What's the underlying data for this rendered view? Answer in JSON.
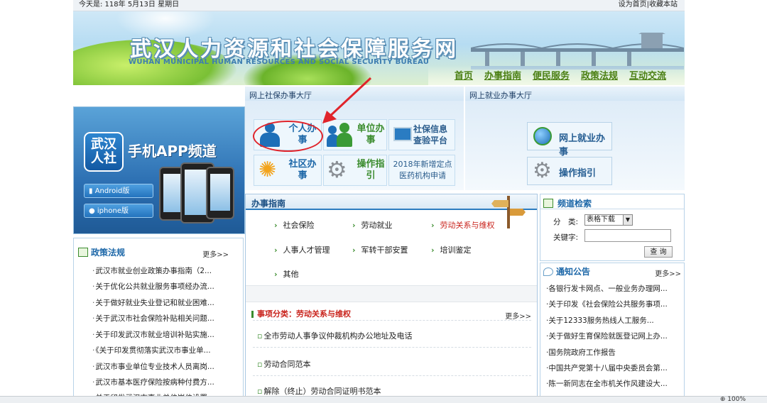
{
  "topbar": {
    "date_text": "今天是: 118年 5月13日 星期日",
    "links": [
      "设为首页",
      "收藏本站"
    ]
  },
  "banner": {
    "title": "武汉人力资源和社会保障服务网",
    "subtitle": "WUHAN MUNICIPAL HUMAN RESOURCES AND SOCIAL SECURITY BUREAU",
    "nav": [
      "首页",
      "办事指南",
      "便民服务",
      "政策法规",
      "互动交流"
    ]
  },
  "app_panel": {
    "logo_text": "武汉人社",
    "title": "手机APP频道",
    "buttons": [
      "Android版",
      "iphone版"
    ]
  },
  "social_hall": {
    "title": "网上社保办事大厅",
    "tiles": [
      {
        "label": "个人办事",
        "icon": "person-icon"
      },
      {
        "label": "单位办事",
        "icon": "group-icon"
      },
      {
        "label": "社保信息查验平台",
        "icon": "monitor-icon"
      },
      {
        "label": "社区办事",
        "icon": "flower-icon"
      },
      {
        "label": "操作指引",
        "icon": "gear-icon"
      },
      {
        "label": "2018年新增定点医药机构申请",
        "icon": ""
      }
    ]
  },
  "job_hall": {
    "title": "网上就业办事大厅",
    "tiles": [
      {
        "label": "网上就业办事",
        "icon": "globe-icon"
      },
      {
        "label": "操作指引",
        "icon": "gear-icon"
      }
    ]
  },
  "guide": {
    "title": "办事指南",
    "items": [
      "社会保险",
      "劳动就业",
      "劳动关系与维权",
      "人事人才管理",
      "军转干部安置",
      "培训鉴定",
      "其他"
    ],
    "active_index": 2,
    "category_label": "事项分类：",
    "category_value": "劳动关系与维权",
    "more": "更多>>",
    "category_items": [
      "全市劳动人事争议仲裁机构办公地址及电话",
      "劳动合同范本",
      "解除（终止）劳动合同证明书范本"
    ]
  },
  "policy": {
    "title": "政策法规",
    "more": "更多>>",
    "items": [
      "武汉市就业创业政策办事指南（2...",
      "关于优化公共就业服务事项经办流...",
      "关于做好就业失业登记和就业困难...",
      "关于武汉市社会保险补贴相关问题...",
      "关于印发武汉市就业培训补贴实施...",
      "《关于印发贯彻落实武汉市事业单...",
      "武汉市事业单位专业技术人员离岗...",
      "武汉市基本医疗保险按病种付费方...",
      "关于印发武汉市事业单位岗位设置..."
    ]
  },
  "search": {
    "title": "频道检索",
    "category_label": "分　类:",
    "category_value": "表格下载",
    "keyword_label": "关键字:",
    "keyword_value": "",
    "button": "查 询"
  },
  "notice": {
    "title": "通知公告",
    "more": "更多>>",
    "items": [
      "·各银行发卡网点、一般业务办理网...",
      "·关于印发《社会保险公共服务事项...",
      "·关于12333服务热线人工服务...",
      "·关于做好生育保险就医登记网上办...",
      "·国务院政府工作报告",
      "·中国共产党第十八届中央委员会第...",
      "·陈一新同志在全市机关作风建设大...",
      "·..."
    ]
  },
  "statusbar": {
    "zoom": "100%"
  },
  "colors": {
    "accent_blue": "#1c67a8",
    "accent_green": "#3b8c2e",
    "annotation_red": "#e0242b",
    "active_red": "#c9231c"
  }
}
